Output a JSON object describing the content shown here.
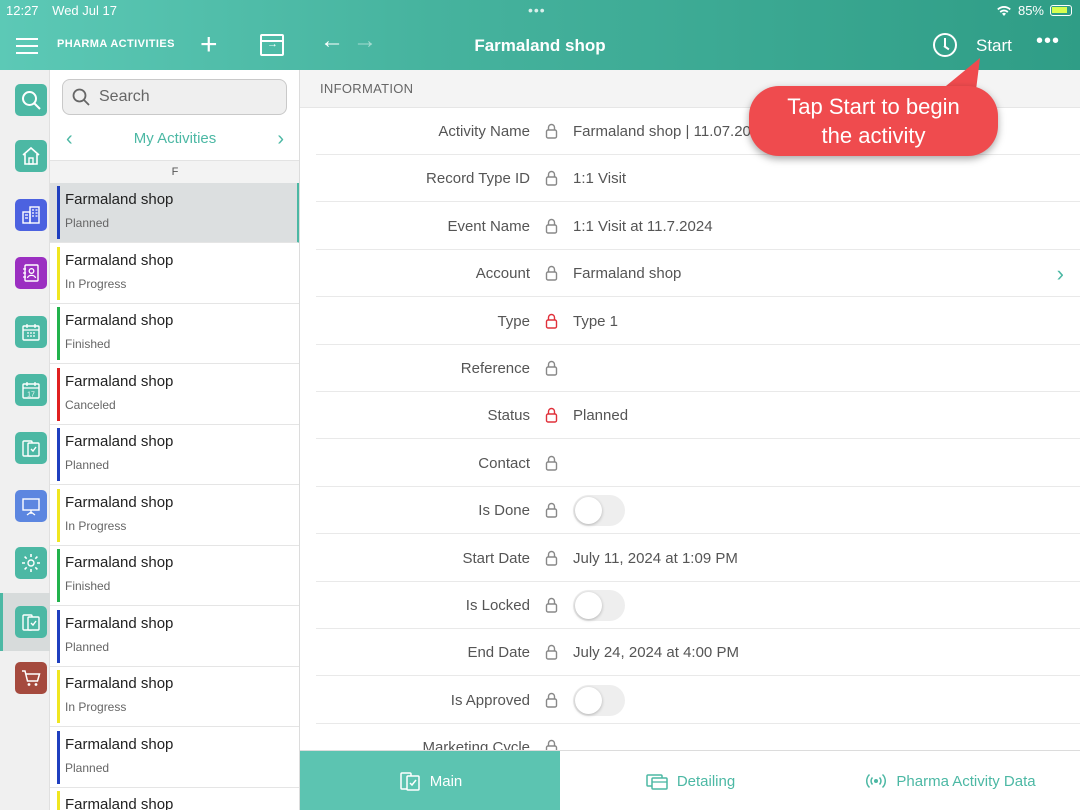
{
  "status_bar": {
    "time": "12:27",
    "date": "Wed Jul 17",
    "battery": "85%"
  },
  "app": {
    "title": "PHARMA ACTIVITIES"
  },
  "header": {
    "title": "Farmaland shop",
    "start_label": "Start",
    "more_label": "•••"
  },
  "search": {
    "placeholder": "Search"
  },
  "list": {
    "title": "My Activities",
    "section": "F",
    "items": [
      {
        "name": "Farmaland shop",
        "status": "Planned",
        "color": "#1f3fbf"
      },
      {
        "name": "Farmaland shop",
        "status": "In Progress",
        "color": "#f0e620"
      },
      {
        "name": "Farmaland shop",
        "status": "Finished",
        "color": "#22b24c"
      },
      {
        "name": "Farmaland shop",
        "status": "Canceled",
        "color": "#e02020"
      },
      {
        "name": "Farmaland shop",
        "status": "Planned",
        "color": "#1f3fbf"
      },
      {
        "name": "Farmaland shop",
        "status": "In Progress",
        "color": "#f0e620"
      },
      {
        "name": "Farmaland shop",
        "status": "Finished",
        "color": "#22b24c"
      },
      {
        "name": "Farmaland shop",
        "status": "Planned",
        "color": "#1f3fbf"
      },
      {
        "name": "Farmaland shop",
        "status": "In Progress",
        "color": "#f0e620"
      },
      {
        "name": "Farmaland shop",
        "status": "Planned",
        "color": "#1f3fbf"
      },
      {
        "name": "Farmaland shop",
        "status": "",
        "color": "#f0e620"
      }
    ]
  },
  "detail": {
    "section_title": "INFORMATION",
    "fields": {
      "activity_name": {
        "label": "Activity Name",
        "value": "Farmaland shop | 11.07.20"
      },
      "record_type_id": {
        "label": "Record Type ID",
        "value": "1:1 Visit"
      },
      "event_name": {
        "label": "Event Name",
        "value": "1:1 Visit at 11.7.2024"
      },
      "account": {
        "label": "Account",
        "value": "Farmaland shop"
      },
      "type": {
        "label": "Type",
        "value": "Type 1"
      },
      "reference": {
        "label": "Reference",
        "value": ""
      },
      "status": {
        "label": "Status",
        "value": "Planned"
      },
      "contact": {
        "label": "Contact",
        "value": ""
      },
      "is_done": {
        "label": "Is Done",
        "value": false
      },
      "start_date": {
        "label": "Start Date",
        "value": "July 11, 2024 at 1:09 PM"
      },
      "is_locked": {
        "label": "Is Locked",
        "value": false
      },
      "end_date": {
        "label": "End Date",
        "value": "July 24, 2024 at 4:00 PM"
      },
      "is_approved": {
        "label": "Is Approved",
        "value": false
      },
      "marketing_cycle": {
        "label": "Marketing Cycle",
        "value": ""
      }
    }
  },
  "tabs": {
    "main": "Main",
    "detailing": "Detailing",
    "pharma_data": "Pharma Activity Data"
  },
  "callout": {
    "line1": "Tap Start to begin",
    "line2": "the activity"
  },
  "colors": {
    "accent": "#4cb8a4",
    "callout": "#ef4b4e",
    "required_lock": "#e0303a"
  }
}
